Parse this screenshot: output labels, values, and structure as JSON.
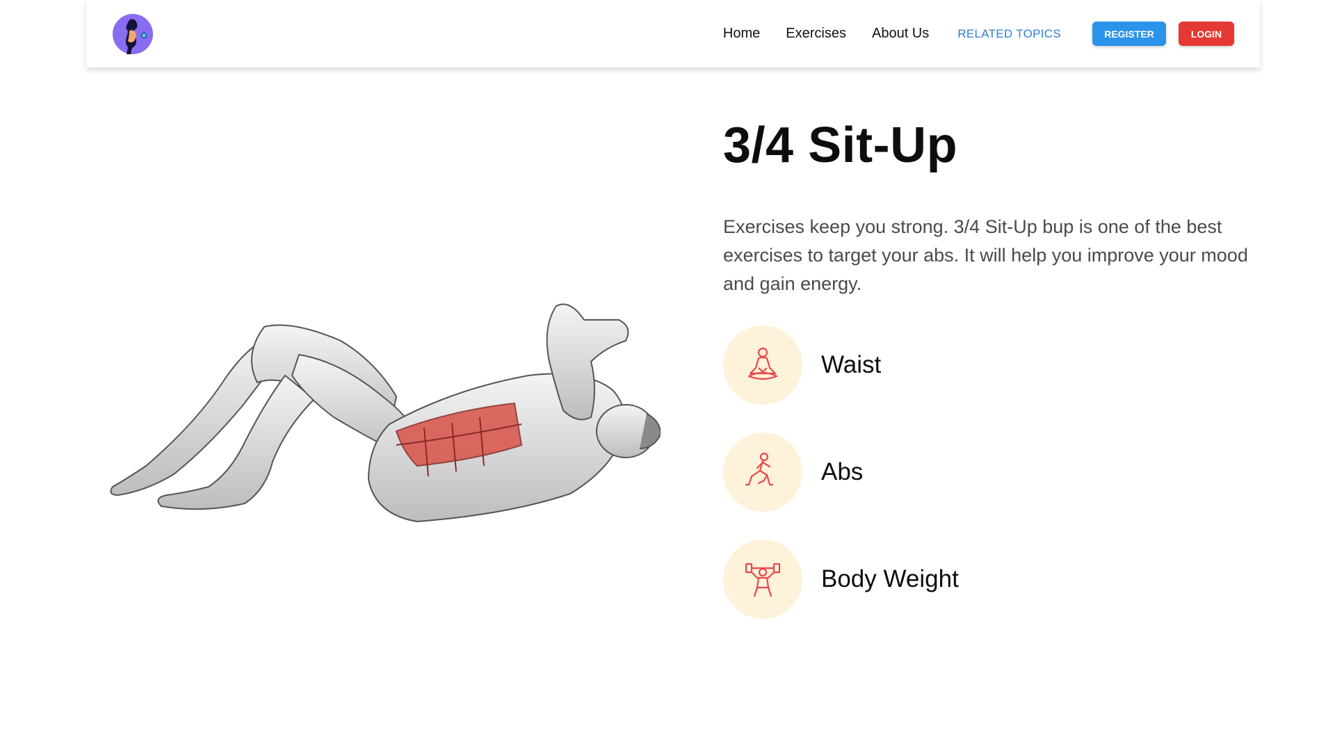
{
  "nav": {
    "links": [
      "Home",
      "Exercises",
      "About Us"
    ],
    "related": "RELATED TOPICS",
    "register": "REGISTER",
    "login": "LOGIN"
  },
  "exercise": {
    "title": "3/4 Sit-Up",
    "description": "Exercises keep you strong. 3/4 Sit-Up bup is one of the best exercises to target your abs. It will help you improve your mood and gain energy.",
    "tags": [
      {
        "label": "Waist",
        "icon": "meditation-icon"
      },
      {
        "label": "Abs",
        "icon": "lunge-icon"
      },
      {
        "label": "Body Weight",
        "icon": "weightlifter-icon"
      }
    ]
  },
  "colors": {
    "register": "#2b93ea",
    "login": "#e53935",
    "related": "#2f7fd3",
    "tag_bg": "#fff2db",
    "icon_stroke": "#e8474a",
    "muscle": "#d9534a"
  }
}
